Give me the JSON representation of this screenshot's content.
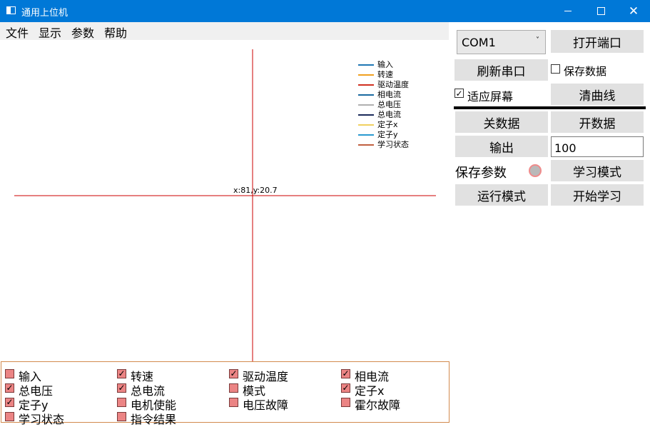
{
  "window": {
    "title": "通用上位机",
    "minimize_glyph": "",
    "maximize_glyph": "",
    "close_glyph": "✕"
  },
  "menu": [
    "文件",
    "显示",
    "参数",
    "帮助"
  ],
  "plot": {
    "crosshair_readout": "x:81,y:20.7",
    "axis_color": "#cc0000",
    "legend": [
      {
        "label": "输入",
        "color": "#1f77b4"
      },
      {
        "label": "转速",
        "color": "#f0a020"
      },
      {
        "label": "驱动温度",
        "color": "#d03020"
      },
      {
        "label": "相电流",
        "color": "#1a6aa0"
      },
      {
        "label": "总电压",
        "color": "#b0b0b0"
      },
      {
        "label": "总电流",
        "color": "#1a2a5a"
      },
      {
        "label": "定子x",
        "color": "#f0d060"
      },
      {
        "label": "定子y",
        "color": "#2a9ad0"
      },
      {
        "label": "学习状态",
        "color": "#c06040"
      }
    ]
  },
  "controls": {
    "port_select_value": "COM1",
    "port_arrow": "˅",
    "open_port": "打开端口",
    "refresh_port": "刷新串口",
    "save_data_label": "保存数据",
    "save_data_checked": false,
    "fit_screen_label": "适应屏幕",
    "fit_screen_checked": true,
    "check_glyph": "✓",
    "clear_curves": "清曲线",
    "close_data": "关数据",
    "open_data": "开数据",
    "output_button": "输出",
    "output_value": "100",
    "save_params_label": "保存参数",
    "learn_mode": "学习模式",
    "run_mode": "运行模式",
    "start_learning": "开始学习"
  },
  "checkboxes": [
    {
      "label": "输入",
      "checked": false
    },
    {
      "label": "转速",
      "checked": true
    },
    {
      "label": "驱动温度",
      "checked": true
    },
    {
      "label": "相电流",
      "checked": true
    },
    {
      "label": "总电压",
      "checked": true
    },
    {
      "label": "总电流",
      "checked": true
    },
    {
      "label": "模式",
      "checked": false
    },
    {
      "label": "定子x",
      "checked": true
    },
    {
      "label": "定子y",
      "checked": true
    },
    {
      "label": "电机使能",
      "checked": false
    },
    {
      "label": "电压故障",
      "checked": false
    },
    {
      "label": "霍尔故障",
      "checked": false
    },
    {
      "label": "学习状态",
      "checked": false
    },
    {
      "label": "指令结果",
      "checked": false
    }
  ]
}
